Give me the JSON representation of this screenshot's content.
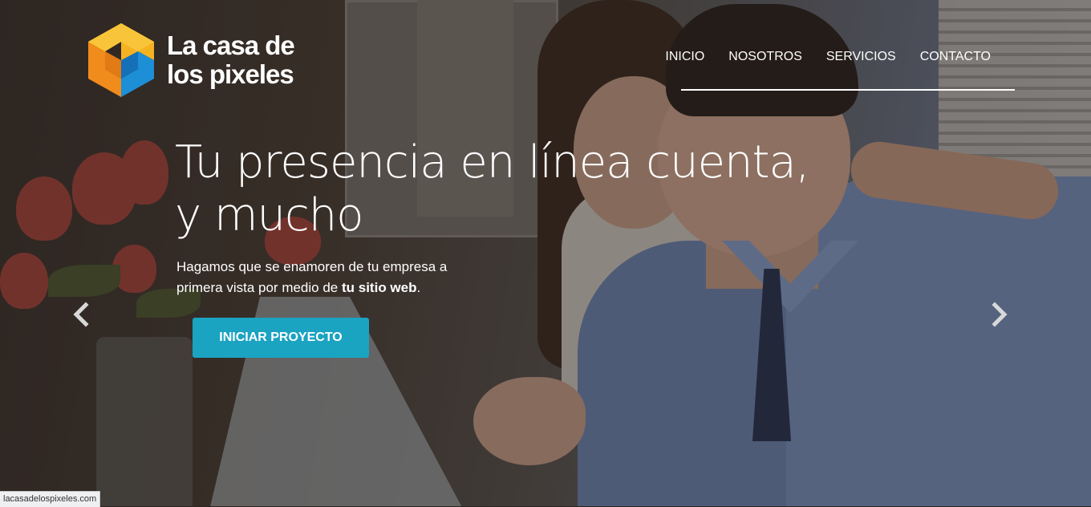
{
  "brand": {
    "line1": "La casa de",
    "line2": "los pixeles",
    "logo_icon": "pixel-cube-logo",
    "colors": {
      "orange": "#f39a1d",
      "blue": "#1d8fd6",
      "accent": "#1ba3c2"
    }
  },
  "nav": {
    "items": [
      {
        "label": "INICIO"
      },
      {
        "label": "NOSOTROS"
      },
      {
        "label": "SERVICIOS"
      },
      {
        "label": "CONTACTO"
      }
    ]
  },
  "hero": {
    "headline_line1": "Tu presencia en línea cuenta,",
    "headline_line2": "y mucho",
    "subtext_part1": "Hagamos que se enamoren de tu empresa a primera vista por medio de ",
    "subtext_bold": "tu sitio web",
    "subtext_end": ".",
    "cta_label": "INICIAR PROYECTO"
  },
  "carousel": {
    "prev_icon": "chevron-left-icon",
    "next_icon": "chevron-right-icon"
  },
  "status_bar": {
    "url": "lacasadelospixeles.com"
  }
}
